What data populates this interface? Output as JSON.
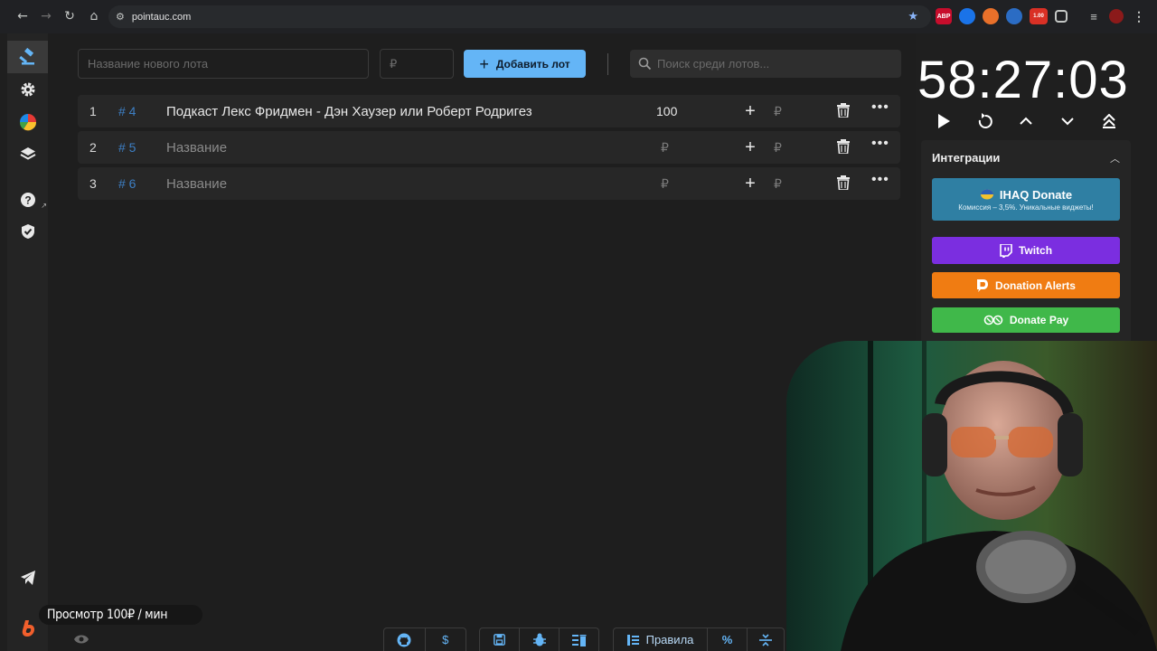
{
  "browser": {
    "url": "pointauc.com",
    "extensions": [
      {
        "name": "abp-icon",
        "label": "ABP",
        "color": "#c70d2c"
      },
      {
        "name": "vpn-icon",
        "label": "",
        "color": "#1a73e8"
      },
      {
        "name": "fox-icon",
        "label": "",
        "color": "#e8702a"
      },
      {
        "name": "ext-blue-icon",
        "label": "",
        "color": "#2b6cc4"
      },
      {
        "name": "ext-badge-icon",
        "label": "1.00",
        "color": "#d93025"
      },
      {
        "name": "puzzle-icon",
        "label": "",
        "color": "#5f6368"
      }
    ]
  },
  "toolbar": {
    "name_placeholder": "Название нового лота",
    "price_placeholder": "₽",
    "add_label": "Добавить лот",
    "search_placeholder": "Поиск среди лотов..."
  },
  "lots": [
    {
      "index": "1",
      "fast_id": "# 4",
      "name": "Подкаст Лекс Фридмен - Дэн Хаузер или Роберт Родригез",
      "placeholder": "Название",
      "amount": "100",
      "amount_placeholder": "₽",
      "add_placeholder": "₽"
    },
    {
      "index": "2",
      "fast_id": "# 5",
      "name": "",
      "placeholder": "Название",
      "amount": "",
      "amount_placeholder": "₽",
      "add_placeholder": "₽"
    },
    {
      "index": "3",
      "fast_id": "# 6",
      "name": "",
      "placeholder": "Название",
      "amount": "",
      "amount_placeholder": "₽",
      "add_placeholder": "₽"
    }
  ],
  "timer": {
    "value": "58:27:03"
  },
  "integrations": {
    "title": "Интеграции",
    "ihaq": {
      "label": "IHAQ Donate",
      "sub": "Комиссия – 3,5%. Уникальные виджеты!"
    },
    "twitch": {
      "label": "Twitch"
    },
    "donation_alerts": {
      "label": "Donation Alerts"
    },
    "donate_pay": {
      "label": "Donate Pay"
    }
  },
  "bottom": {
    "badge": "Просмотр 100₽ / мин",
    "rules_label": "Правила",
    "percent_label": "%",
    "dollar_label": "$"
  },
  "colors": {
    "accent": "#64b5f6",
    "fast_id": "#3d7fc4",
    "twitch": "#7b2ee0",
    "donation_alerts": "#f07c12",
    "donate_pay": "#40b84a",
    "ihaq": "#2f7fa3"
  }
}
